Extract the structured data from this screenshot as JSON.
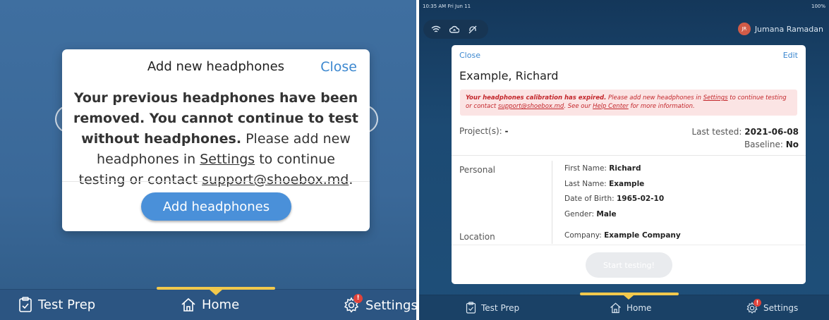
{
  "left": {
    "modal": {
      "title": "Add new headphones",
      "close_label": "Close",
      "body_bold_1": "Your previous headphones have been removed. You cannot continue to test without headphones.",
      "body_text_1": " Please add new headphones in ",
      "body_link_settings": "Settings",
      "body_text_2": " to continue testing or contact ",
      "body_link_email": "support@shoebox.md",
      "body_text_3": ".",
      "add_button_label": "Add headphones"
    },
    "tabbar": {
      "tabs": [
        {
          "label": "Test Prep",
          "icon": "clipboard-check-icon"
        },
        {
          "label": "Home",
          "icon": "home-icon"
        },
        {
          "label": "Settings",
          "icon": "gear-icon"
        }
      ],
      "settings_badge": "!"
    }
  },
  "right": {
    "status": {
      "time": "10:35 AM  Fri Jun 11",
      "battery": "100%"
    },
    "user": {
      "initials": "JR",
      "name": "Jumana Ramadan"
    },
    "card": {
      "close_label": "Close",
      "edit_label": "Edit",
      "patient_name": "Example, Richard",
      "alert": {
        "bold": "Your headphones calibration has expired.",
        "text_1": " Please add new headphones in ",
        "link_settings": "Settings",
        "text_2": " to continue testing or contact ",
        "link_email": "support@shoebox.md",
        "text_3": ". See our ",
        "link_help": "Help Center",
        "text_4": " for more information."
      },
      "projects_label": "Project(s):",
      "projects_value": "-",
      "last_tested_label": "Last tested:",
      "last_tested_value": "2021-06-08",
      "baseline_label": "Baseline:",
      "baseline_value": "No",
      "personal_label": "Personal",
      "first_name_label": "First Name:",
      "first_name": "Richard",
      "last_name_label": "Last Name:",
      "last_name": "Example",
      "dob_label": "Date of Birth:",
      "dob": "1965-02-10",
      "gender_label": "Gender:",
      "gender": "Male",
      "location_label": "Location",
      "company_label": "Company:",
      "company": "Example Company",
      "start_button_label": "Start testing!"
    },
    "tabbar": {
      "tabs": [
        {
          "label": "Test Prep",
          "icon": "clipboard-check-icon"
        },
        {
          "label": "Home",
          "icon": "home-icon"
        },
        {
          "label": "Settings",
          "icon": "gear-icon"
        }
      ],
      "settings_badge": "!"
    }
  },
  "colors": {
    "accent": "#3b87cf",
    "button": "#4a90d9",
    "indicator": "#f2c94c",
    "alert_text": "#c3262b",
    "alert_bg": "#fbe4e4",
    "badge": "#e0433b"
  }
}
